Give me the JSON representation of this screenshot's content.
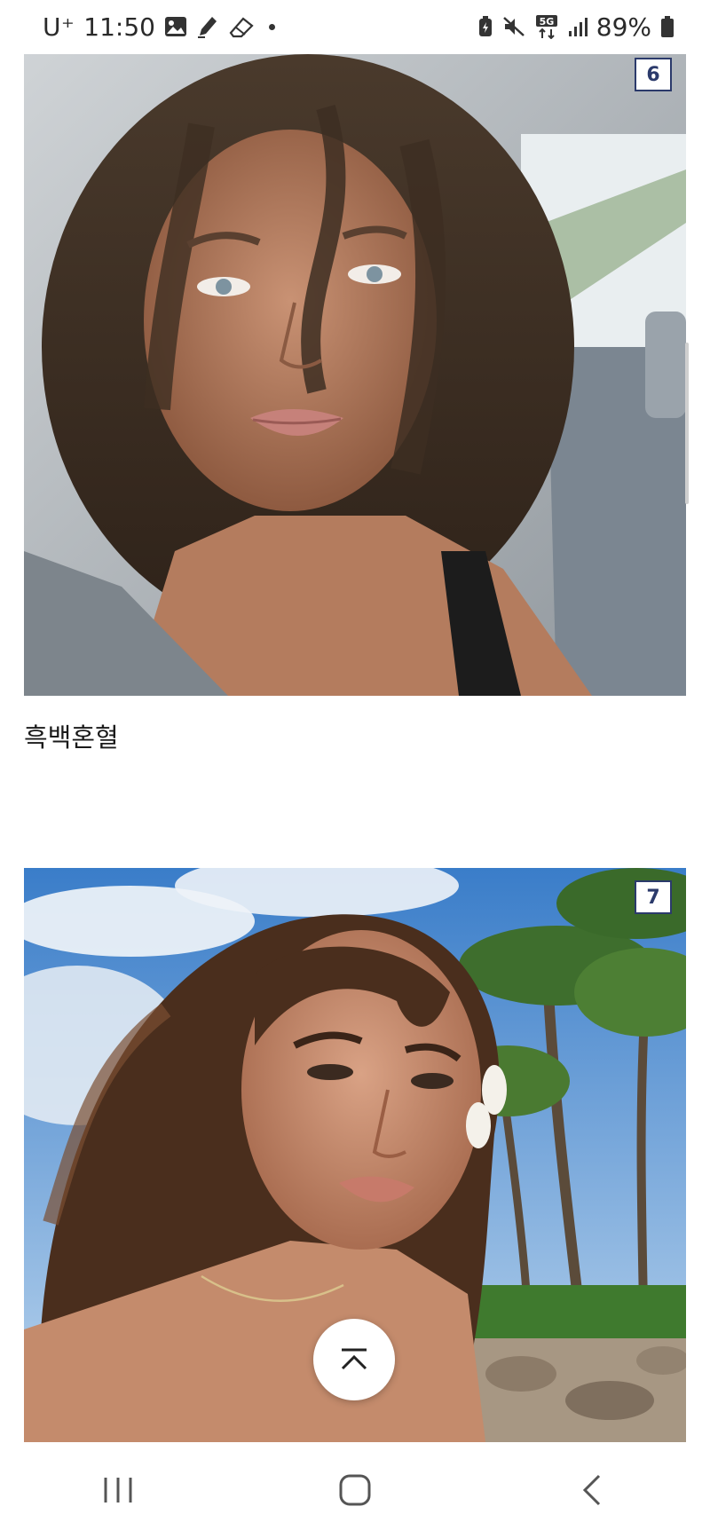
{
  "status_bar": {
    "carrier": "U⁺",
    "time": "11:50",
    "network": "5G",
    "battery": "89%",
    "icons_left": [
      "gallery-icon",
      "pen-icon",
      "eraser-icon",
      "notification-dot"
    ],
    "icons_right": [
      "battery-saver-icon",
      "mute-icon",
      "5g-icon",
      "signal-icon",
      "battery-icon"
    ]
  },
  "posts": [
    {
      "number": "6",
      "caption": "흑백혼혈"
    },
    {
      "number": "7",
      "caption": ""
    }
  ],
  "colors": {
    "badge": "#2b3a6b",
    "background": "#ffffff"
  },
  "nav": {
    "buttons": [
      "recent-apps",
      "home",
      "back"
    ]
  }
}
